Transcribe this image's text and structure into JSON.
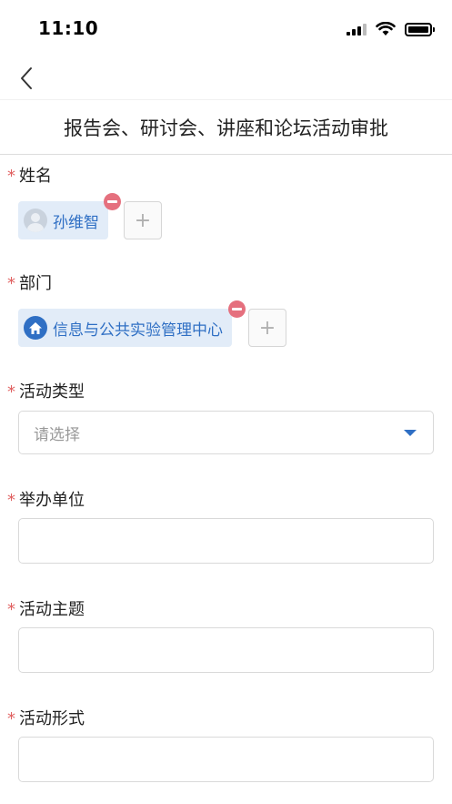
{
  "status_bar": {
    "time": "11:10"
  },
  "page": {
    "title": "报告会、研讨会、讲座和论坛活动审批"
  },
  "fields": {
    "name": {
      "label": "姓名",
      "required_mark": "*",
      "chip": "孙维智",
      "add": "+"
    },
    "department": {
      "label": "部门",
      "required_mark": "*",
      "chip": "信息与公共实验管理中心",
      "add": "+"
    },
    "activity_type": {
      "label": "活动类型",
      "required_mark": "*",
      "placeholder": "请选择"
    },
    "organizer": {
      "label": "举办单位",
      "required_mark": "*",
      "value": ""
    },
    "theme": {
      "label": "活动主题",
      "required_mark": "*",
      "value": ""
    },
    "format": {
      "label": "活动形式",
      "required_mark": "*",
      "value": ""
    }
  },
  "colors": {
    "accent": "#2f6fc4",
    "required": "#e06060",
    "chip_bg": "#e2ecf8",
    "remove": "#e5707e"
  }
}
